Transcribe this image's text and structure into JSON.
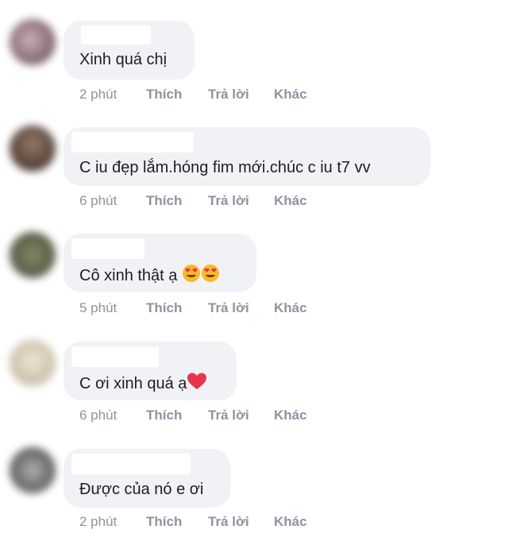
{
  "comments": [
    {
      "text": "Xinh quá chị",
      "time": "2 phút"
    },
    {
      "text": "C iu đẹp lắm.hóng fim mới.chúc c iu t7 vv",
      "time": "6 phút"
    },
    {
      "text": "Cô xinh thật ạ",
      "time": "5 phút"
    },
    {
      "text": "C ơi xinh quá ạ",
      "time": "6 phút"
    },
    {
      "text": "Được của nó e ơi",
      "time": "2 phút"
    }
  ],
  "actions": {
    "like": "Thích",
    "reply": "Trả lời",
    "more": "Khác"
  },
  "colors": {
    "bubble": "#f0f2f5",
    "meta": "#8d949e",
    "text": "#1c1e21",
    "heart": "#e8344e",
    "emoji_face": "#f7b928"
  }
}
